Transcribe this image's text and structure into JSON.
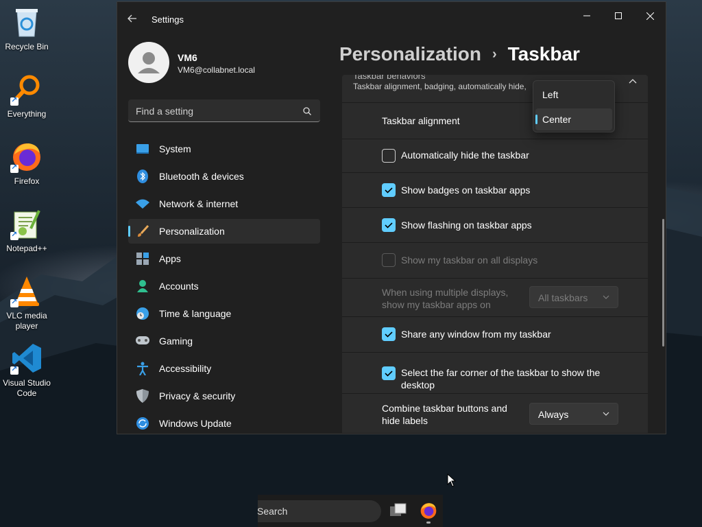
{
  "desktop": {
    "icons": [
      {
        "label": "Recycle Bin",
        "icon": "recycle-bin-icon"
      },
      {
        "label": "Everything",
        "icon": "everything-icon"
      },
      {
        "label": "Firefox",
        "icon": "firefox-icon"
      },
      {
        "label": "Notepad++",
        "icon": "notepadpp-icon"
      },
      {
        "label": "VLC media player",
        "icon": "vlc-icon"
      },
      {
        "label": "Visual Studio Code",
        "icon": "vscode-icon"
      }
    ]
  },
  "window": {
    "title": "Settings",
    "controls": [
      "minimize",
      "maximize",
      "close"
    ]
  },
  "user": {
    "name": "VM6",
    "email": "VM6@collabnet.local"
  },
  "search": {
    "placeholder": "Find a setting"
  },
  "nav": {
    "items": [
      {
        "label": "System",
        "icon": "system-icon",
        "active": false
      },
      {
        "label": "Bluetooth & devices",
        "icon": "bluetooth-icon",
        "active": false
      },
      {
        "label": "Network & internet",
        "icon": "wifi-icon",
        "active": false
      },
      {
        "label": "Personalization",
        "icon": "brush-icon",
        "active": true
      },
      {
        "label": "Apps",
        "icon": "apps-icon",
        "active": false
      },
      {
        "label": "Accounts",
        "icon": "accounts-icon",
        "active": false
      },
      {
        "label": "Time & language",
        "icon": "globe-clock-icon",
        "active": false
      },
      {
        "label": "Gaming",
        "icon": "gamepad-icon",
        "active": false
      },
      {
        "label": "Accessibility",
        "icon": "accessibility-icon",
        "active": false
      },
      {
        "label": "Privacy & security",
        "icon": "shield-icon",
        "active": false
      },
      {
        "label": "Windows Update",
        "icon": "update-icon",
        "active": false
      }
    ]
  },
  "header": {
    "breadcrumb_parent": "Personalization",
    "separator": "›",
    "title": "Taskbar"
  },
  "taskbar_behaviors": {
    "title": "Taskbar behaviors",
    "subtitle": "Taskbar alignment, badging, automatically hide,",
    "alignment_label": "Taskbar alignment",
    "alignment_options": [
      "Left",
      "Center"
    ],
    "alignment_selected": "Center",
    "auto_hide": {
      "label": "Automatically hide the taskbar",
      "checked": false
    },
    "badges": {
      "label": "Show badges on taskbar apps",
      "checked": true
    },
    "flashing": {
      "label": "Show flashing on taskbar apps",
      "checked": true
    },
    "all_displays": {
      "label": "Show my taskbar on all displays",
      "checked": false,
      "disabled": true
    },
    "multi_display": {
      "label_line1": "When using multiple displays,",
      "label_line2": "show my taskbar apps on",
      "value": "All taskbars",
      "disabled": true
    },
    "share_window": {
      "label": "Share any window from my taskbar",
      "checked": true
    },
    "far_corner": {
      "label_line1": "Select the far corner of the taskbar to show the",
      "label_line2": "desktop",
      "checked": true
    },
    "combine": {
      "label_line1": "Combine taskbar buttons and",
      "label_line2": "hide labels",
      "value": "Always"
    }
  },
  "taskbar": {
    "search_text": "Search",
    "apps": [
      "task-view-icon",
      "firefox-icon"
    ]
  },
  "colors": {
    "accent": "#60cdff",
    "window_bg": "#202020",
    "card_bg": "#2b2b2b"
  }
}
